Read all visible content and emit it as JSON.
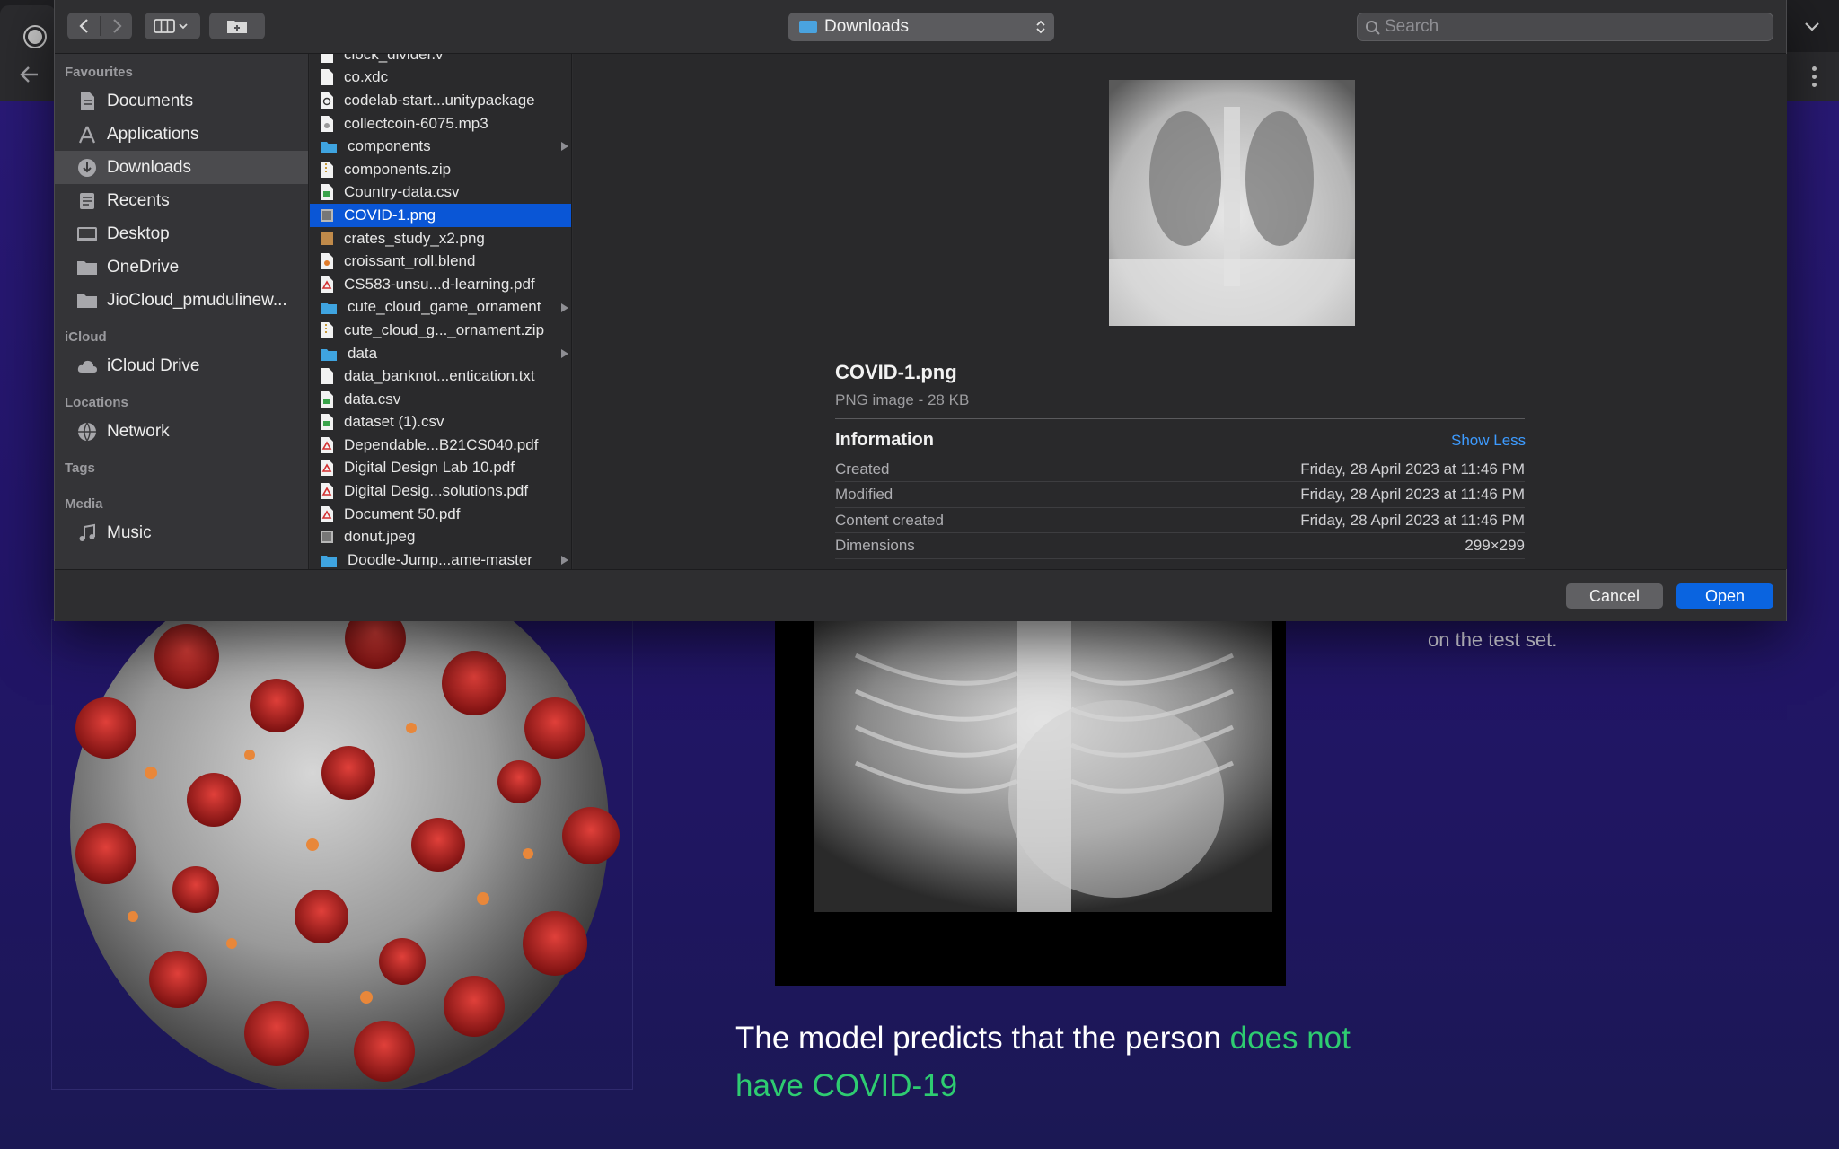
{
  "dialog": {
    "location": "Downloads",
    "search_placeholder": "Search",
    "cancel_label": "Cancel",
    "open_label": "Open"
  },
  "sidebar": {
    "favourites_label": "Favourites",
    "favourites": [
      {
        "label": "Documents",
        "icon": "document-icon"
      },
      {
        "label": "Applications",
        "icon": "applications-icon"
      },
      {
        "label": "Downloads",
        "icon": "downloads-icon"
      },
      {
        "label": "Recents",
        "icon": "recents-icon"
      },
      {
        "label": "Desktop",
        "icon": "desktop-icon"
      },
      {
        "label": "OneDrive",
        "icon": "folder-icon"
      },
      {
        "label": "JioCloud_pmudulinew...",
        "icon": "folder-icon"
      }
    ],
    "icloud_label": "iCloud",
    "icloud_items": [
      {
        "label": "iCloud Drive",
        "icon": "cloud-icon"
      }
    ],
    "locations_label": "Locations",
    "locations": [
      {
        "label": "Network",
        "icon": "network-icon"
      }
    ],
    "tags_label": "Tags",
    "media_label": "Media",
    "media": [
      {
        "label": "Music",
        "icon": "music-icon"
      }
    ]
  },
  "files": [
    {
      "name": "clock_divider.v",
      "type": "doc"
    },
    {
      "name": "co.xdc",
      "type": "doc"
    },
    {
      "name": "codelab-start...unitypackage",
      "type": "unity"
    },
    {
      "name": "collectcoin-6075.mp3",
      "type": "audio"
    },
    {
      "name": "components",
      "type": "folder"
    },
    {
      "name": "components.zip",
      "type": "zip"
    },
    {
      "name": "Country-data.csv",
      "type": "csv"
    },
    {
      "name": "COVID-1.png",
      "type": "image",
      "selected": true
    },
    {
      "name": "crates_study_x2.png",
      "type": "image2"
    },
    {
      "name": "croissant_roll.blend",
      "type": "blend"
    },
    {
      "name": "CS583-unsu...d-learning.pdf",
      "type": "pdf"
    },
    {
      "name": "cute_cloud_game_ornament",
      "type": "folder"
    },
    {
      "name": "cute_cloud_g..._ornament.zip",
      "type": "zip"
    },
    {
      "name": "data",
      "type": "folder"
    },
    {
      "name": "data_banknot...entication.txt",
      "type": "doc"
    },
    {
      "name": "data.csv",
      "type": "csv"
    },
    {
      "name": "dataset (1).csv",
      "type": "csv"
    },
    {
      "name": "Dependable...B21CS040.pdf",
      "type": "pdf"
    },
    {
      "name": "Digital Design Lab 10.pdf",
      "type": "pdf"
    },
    {
      "name": "Digital Desig...solutions.pdf",
      "type": "pdf"
    },
    {
      "name": "Document 50.pdf",
      "type": "pdf"
    },
    {
      "name": "donut.jpeg",
      "type": "image"
    },
    {
      "name": "Doodle-Jump...ame-master",
      "type": "folder"
    }
  ],
  "preview": {
    "filename": "COVID-1.png",
    "kind": "PNG image - 28 KB",
    "info_title": "Information",
    "show_less": "Show Less",
    "rows": [
      {
        "label": "Created",
        "value": "Friday, 28 April 2023 at 11:46 PM"
      },
      {
        "label": "Modified",
        "value": "Friday, 28 April 2023 at 11:46 PM"
      },
      {
        "label": "Content created",
        "value": "Friday, 28 April 2023 at 11:46 PM"
      },
      {
        "label": "Dimensions",
        "value": "299×299"
      }
    ]
  },
  "page": {
    "side_text": "on the test set.",
    "prediction_prefix": "The model predicts that the person ",
    "prediction_result": "does not have COVID-19"
  },
  "colors": {
    "accent": "#0a64e0",
    "selected_row": "#0a56d6",
    "prediction_green": "#2ecc71",
    "link_blue": "#3d9bff"
  }
}
